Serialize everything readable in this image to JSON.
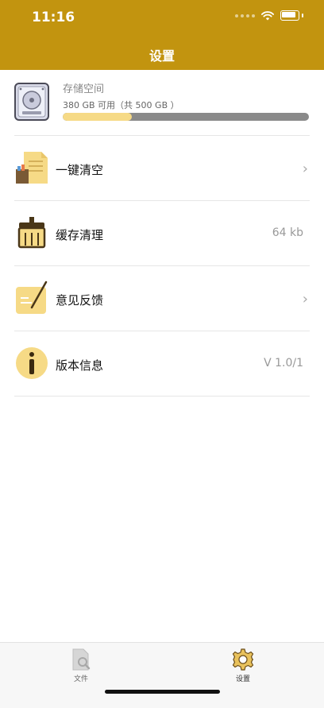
{
  "status_bar": {
    "time": "11:16"
  },
  "header": {
    "title": "设置"
  },
  "storage": {
    "title": "存储空间",
    "subtitle": "380 GB 可用（共 500 GB ）",
    "used_fraction": 0.28
  },
  "rows": [
    {
      "label": "一键清空",
      "value": ""
    },
    {
      "label": "缓存清理",
      "value": "64 kb"
    },
    {
      "label": "意见反馈",
      "value": ""
    },
    {
      "label": "版本信息",
      "value": "V 1.0/1"
    }
  ],
  "tabbar": {
    "tabs": [
      {
        "label": "文件",
        "active": false
      },
      {
        "label": "设置",
        "active": true
      }
    ]
  },
  "colors": {
    "accent": "#c2940f",
    "icon_yellow": "#f6da86",
    "icon_dark": "#5a4220"
  }
}
